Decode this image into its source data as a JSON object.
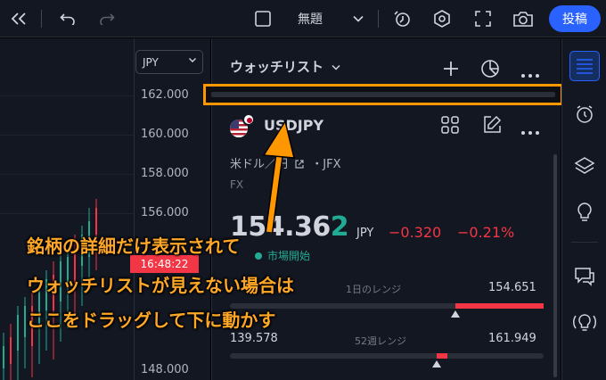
{
  "toolbar": {
    "layout_name": "無題",
    "post_label": "投稿"
  },
  "chart": {
    "currency": "JPY",
    "price_labels": [
      "162.000",
      "160.000",
      "158.000",
      "156.000",
      "148.000"
    ],
    "countdown": "16:48:22"
  },
  "watchlist": {
    "title": "ウォッチリスト",
    "symbol": "USDJPY",
    "description": "米ドル／円",
    "exchange_suffix": "・JFX",
    "type": "FX",
    "price_main": "154.36",
    "price_last_digit": "2",
    "price_unit": "JPY",
    "change": "−0.320",
    "change_pct": "−0.21%",
    "market_status": "市場開始",
    "day_range": {
      "label": "1日のレンジ",
      "low": "",
      "high": "154.651",
      "position": 0.72
    },
    "week52_range": {
      "label": "52週レンジ",
      "low": "139.578",
      "high": "161.949",
      "position": 0.66
    }
  },
  "annotation": {
    "line1": "銘柄の詳細だけ表示されて",
    "line2": "ウォッチリストが見えない場合は",
    "line3": "ここをドラッグして下に動かす"
  },
  "colors": {
    "background": "#131722",
    "accent": "#2962ff",
    "negative": "#f23645",
    "positive": "#22ab94",
    "highlight": "#ff9800"
  }
}
